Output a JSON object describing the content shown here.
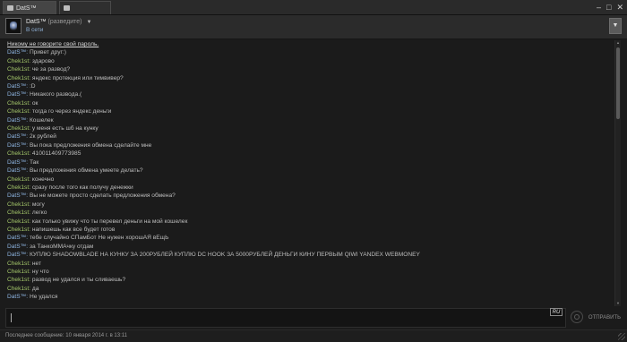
{
  "tabs": [
    {
      "label": "DatS™",
      "active": true
    },
    {
      "label": "",
      "active": false
    }
  ],
  "window_controls": {
    "minimize": "–",
    "restore": "□",
    "close": "✕"
  },
  "header": {
    "name": "DatS™",
    "note": "(разведите)",
    "status": "В сети",
    "menu_icon": "triangle-down"
  },
  "chat": {
    "system_notice": "Никому не говорите свой пароль.",
    "messages": [
      {
        "sender": "DatS™",
        "side": "them",
        "text": "Привет друг:)"
      },
      {
        "sender": "Chek1st",
        "side": "me",
        "text": "здарово"
      },
      {
        "sender": "Chek1st",
        "side": "me",
        "text": "че за развод?"
      },
      {
        "sender": "Chek1st",
        "side": "me",
        "text": "яндекс протекция или тимвивер?"
      },
      {
        "sender": "DatS™",
        "side": "them",
        "text": ":D"
      },
      {
        "sender": "DatS™",
        "side": "them",
        "text": "Никакого развода.("
      },
      {
        "sender": "Chek1st",
        "side": "me",
        "text": "ок"
      },
      {
        "sender": "Chek1st",
        "side": "me",
        "text": "тогда го через яндекс деньги"
      },
      {
        "sender": "DatS™",
        "side": "them",
        "text": "Кошелек"
      },
      {
        "sender": "Chek1st",
        "side": "me",
        "text": "у меня есть шб на кунку"
      },
      {
        "sender": "DatS™",
        "side": "them",
        "text": "2к рублей"
      },
      {
        "sender": "DatS™",
        "side": "them",
        "text": "Вы пока предложения обмена сделайте мне"
      },
      {
        "sender": "Chek1st",
        "side": "me",
        "text": "410011409773985"
      },
      {
        "sender": "DatS™",
        "side": "them",
        "text": "Так"
      },
      {
        "sender": "DatS™",
        "side": "them",
        "text": "Вы предложения обмена умеете делать?"
      },
      {
        "sender": "Chek1st",
        "side": "me",
        "text": "конечно"
      },
      {
        "sender": "Chek1st",
        "side": "me",
        "text": "сразу после того как получу денежки"
      },
      {
        "sender": "DatS™",
        "side": "them",
        "text": "Вы не можете просто сделать предложения обмена?"
      },
      {
        "sender": "Chek1st",
        "side": "me",
        "text": "могу"
      },
      {
        "sender": "Chek1st",
        "side": "me",
        "text": "легко"
      },
      {
        "sender": "Chek1st",
        "side": "me",
        "text": "как только увижу что ты перевел деньги на мой кошелек"
      },
      {
        "sender": "Chek1st",
        "side": "me",
        "text": "напишешь как все будет готов"
      },
      {
        "sender": "DatS™",
        "side": "them",
        "text": "тебе случайно СПамБот Не нужен хорошАЯ вЕщЬ"
      },
      {
        "sender": "DatS™",
        "side": "them",
        "text": "за ТанкоММАчку отдам"
      },
      {
        "sender": "DatS™",
        "side": "them",
        "text": "КУПЛЮ SHADOWBLADE НА КУНКУ ЗА 200РУБЛЕЙ КУПЛЮ DC HOOK ЗА 5000РУБЛЕЙ ДЕНЬГИ КИНУ ПЕРВЫМ QIWI YANDEX WEBMONEY"
      },
      {
        "sender": "Chek1st",
        "side": "me",
        "text": "нет"
      },
      {
        "sender": "Chek1st",
        "side": "me",
        "text": "ну что"
      },
      {
        "sender": "Chek1st",
        "side": "me",
        "text": "развод не удался и ты сливаешь?"
      },
      {
        "sender": "Chek1st",
        "side": "me",
        "text": "да"
      },
      {
        "sender": "DatS™",
        "side": "them",
        "text": "Не удался"
      }
    ]
  },
  "input": {
    "value": "",
    "lang_indicator": "RU"
  },
  "send_button": "ОТПРАВИТЬ",
  "footer": {
    "last_message": "Последнее сообщение: 10 января 2014 г. в 13:11"
  },
  "colors": {
    "them": "#8fb6e3",
    "me": "#a4c76a",
    "background": "#1b1b1b"
  }
}
